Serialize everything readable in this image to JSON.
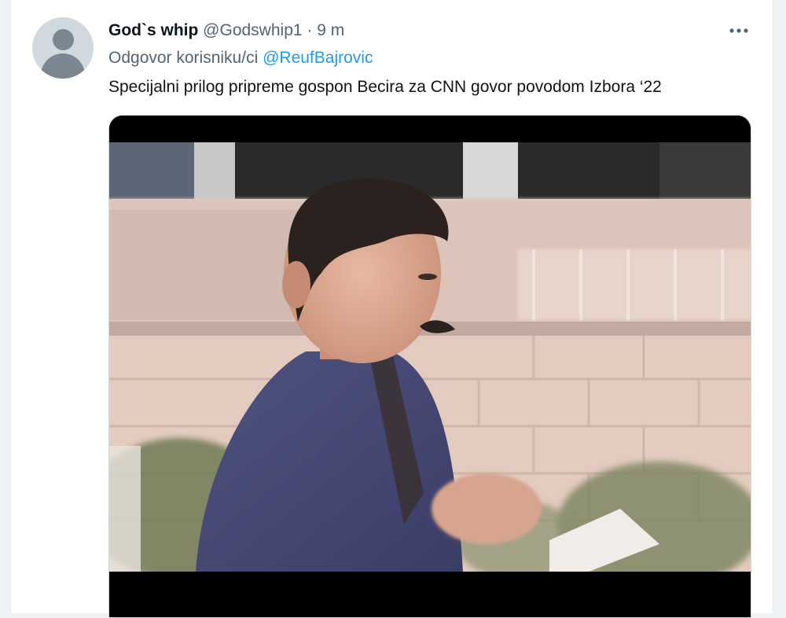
{
  "tweet": {
    "display_name": "God`s whip",
    "handle": "@Godswhip1",
    "separator": "·",
    "time": "9 m",
    "reply_prefix": "Odgovor korisniku/ci",
    "reply_mention": "@ReufBajrovic",
    "text": "Specijalni prilog pripreme gospon Becira za CNN govor povodom Izbora ‘22",
    "more_icon": "more-horizontal-icon",
    "avatar_icon": "default-avatar-icon"
  },
  "colors": {
    "name": "#0f1419",
    "secondary": "#536471",
    "link": "#1d9bf0"
  }
}
